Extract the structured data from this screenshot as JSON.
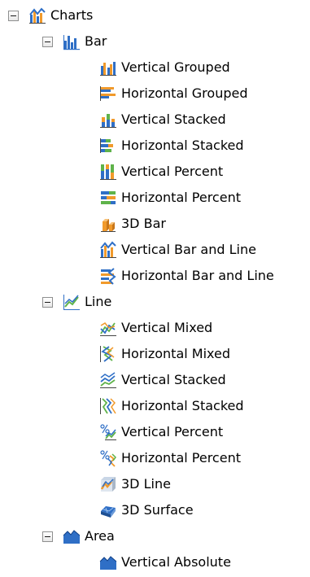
{
  "tree": {
    "root": {
      "label": "Charts",
      "icon": "charts-folder-icon",
      "children": [
        {
          "label": "Bar",
          "icon": "bar-chart-icon",
          "items": [
            {
              "label": "Vertical Grouped",
              "icon": "vertical-grouped-bar-icon"
            },
            {
              "label": "Horizontal Grouped",
              "icon": "horizontal-grouped-bar-icon"
            },
            {
              "label": "Vertical Stacked",
              "icon": "vertical-stacked-bar-icon"
            },
            {
              "label": "Horizontal Stacked",
              "icon": "horizontal-stacked-bar-icon"
            },
            {
              "label": "Vertical Percent",
              "icon": "vertical-percent-bar-icon"
            },
            {
              "label": "Horizontal Percent",
              "icon": "horizontal-percent-bar-icon"
            },
            {
              "label": "3D Bar",
              "icon": "3d-bar-icon"
            },
            {
              "label": "Vertical Bar and Line",
              "icon": "vertical-bar-and-line-icon"
            },
            {
              "label": "Horizontal Bar and Line",
              "icon": "horizontal-bar-and-line-icon"
            }
          ]
        },
        {
          "label": "Line",
          "icon": "line-chart-icon",
          "items": [
            {
              "label": "Vertical Mixed",
              "icon": "vertical-mixed-line-icon"
            },
            {
              "label": "Horizontal Mixed",
              "icon": "horizontal-mixed-line-icon"
            },
            {
              "label": "Vertical Stacked",
              "icon": "vertical-stacked-line-icon"
            },
            {
              "label": "Horizontal Stacked",
              "icon": "horizontal-stacked-line-icon"
            },
            {
              "label": "Vertical Percent",
              "icon": "vertical-percent-line-icon"
            },
            {
              "label": "Horizontal Percent",
              "icon": "horizontal-percent-line-icon"
            },
            {
              "label": "3D Line",
              "icon": "3d-line-icon"
            },
            {
              "label": "3D Surface",
              "icon": "3d-surface-icon"
            }
          ]
        },
        {
          "label": "Area",
          "icon": "area-chart-icon",
          "items": [
            {
              "label": "Vertical Absolute",
              "icon": "vertical-absolute-area-icon"
            }
          ]
        }
      ]
    }
  },
  "colors": {
    "blue": "#2f6fc6",
    "orange": "#f19a2b",
    "green": "#5fb34a",
    "gray": "#8e8f8f"
  }
}
